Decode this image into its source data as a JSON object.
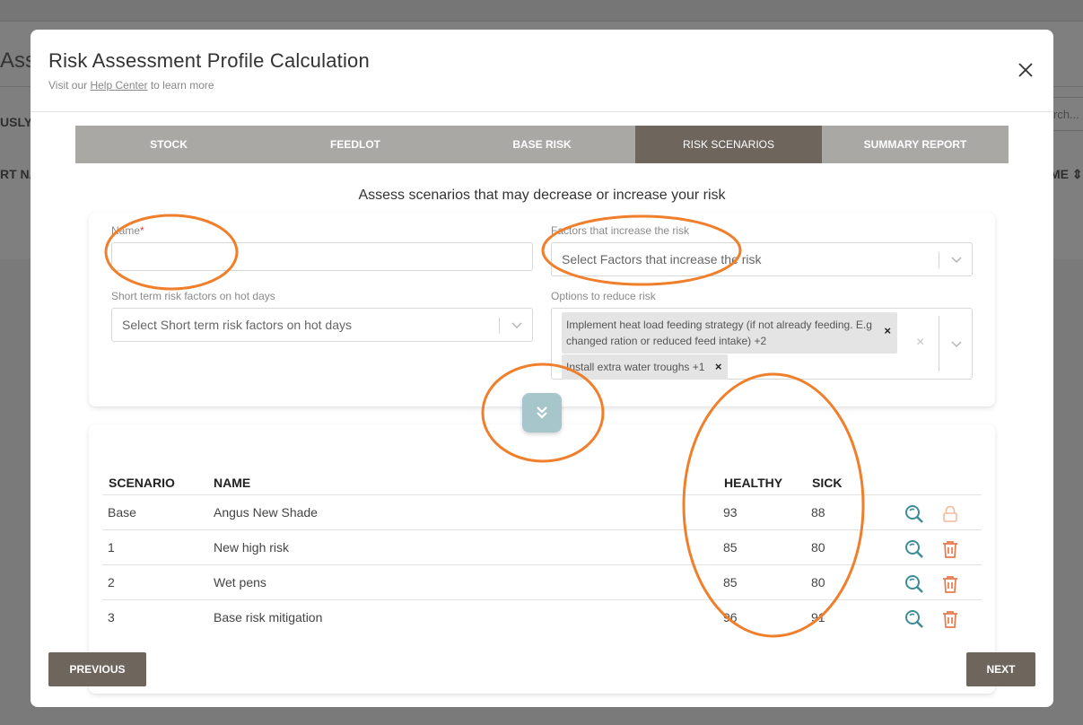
{
  "background": {
    "title": "Ass",
    "col1": "USLY",
    "col2": "RT NA",
    "col3": "ME ⇕",
    "search": "rch..."
  },
  "modal": {
    "title": "Risk Assessment Profile Calculation",
    "sub_prefix": "Visit our ",
    "sub_link": "Help Center",
    "sub_suffix": " to learn more"
  },
  "tabs": [
    {
      "label": "STOCK",
      "active": false
    },
    {
      "label": "FEEDLOT",
      "active": false
    },
    {
      "label": "BASE RISK",
      "active": false
    },
    {
      "label": "RISK SCENARIOS",
      "active": true
    },
    {
      "label": "SUMMARY REPORT",
      "active": false
    }
  ],
  "subtitle": "Assess scenarios that may decrease or increase your risk",
  "form": {
    "name_label": "Name",
    "name_required": "*",
    "name_value": "",
    "factors_label": "Factors that increase the risk",
    "factors_placeholder": "Select Factors that increase the risk",
    "short_term_label": "Short term risk factors on hot days",
    "short_term_placeholder": "Select Short term risk factors on hot days",
    "options_label": "Options to reduce risk",
    "options_tags": [
      "Implement heat load feeding strategy (if not already feeding. E.g changed ration or reduced feed intake) +2",
      "Install extra water troughs +1"
    ]
  },
  "table": {
    "headers": [
      "SCENARIO",
      "NAME",
      "HEALTHY",
      "SICK"
    ],
    "rows": [
      {
        "scenario": "Base",
        "name": "Angus New Shade",
        "healthy": "93",
        "sick": "88",
        "locked": true
      },
      {
        "scenario": "1",
        "name": "New high risk",
        "healthy": "85",
        "sick": "80",
        "locked": false
      },
      {
        "scenario": "2",
        "name": "Wet pens",
        "healthy": "85",
        "sick": "80",
        "locked": false
      },
      {
        "scenario": "3",
        "name": "Base risk mitigation",
        "healthy": "96",
        "sick": "91",
        "locked": false
      }
    ]
  },
  "buttons": {
    "previous": "PREVIOUS",
    "next": "NEXT"
  },
  "colors": {
    "tab_active": "#6e665d",
    "tab_bg": "#a9a8a5",
    "icon_teal": "#3d8c98",
    "icon_orange": "#e67a4c",
    "annotation": "#f07f2c"
  }
}
